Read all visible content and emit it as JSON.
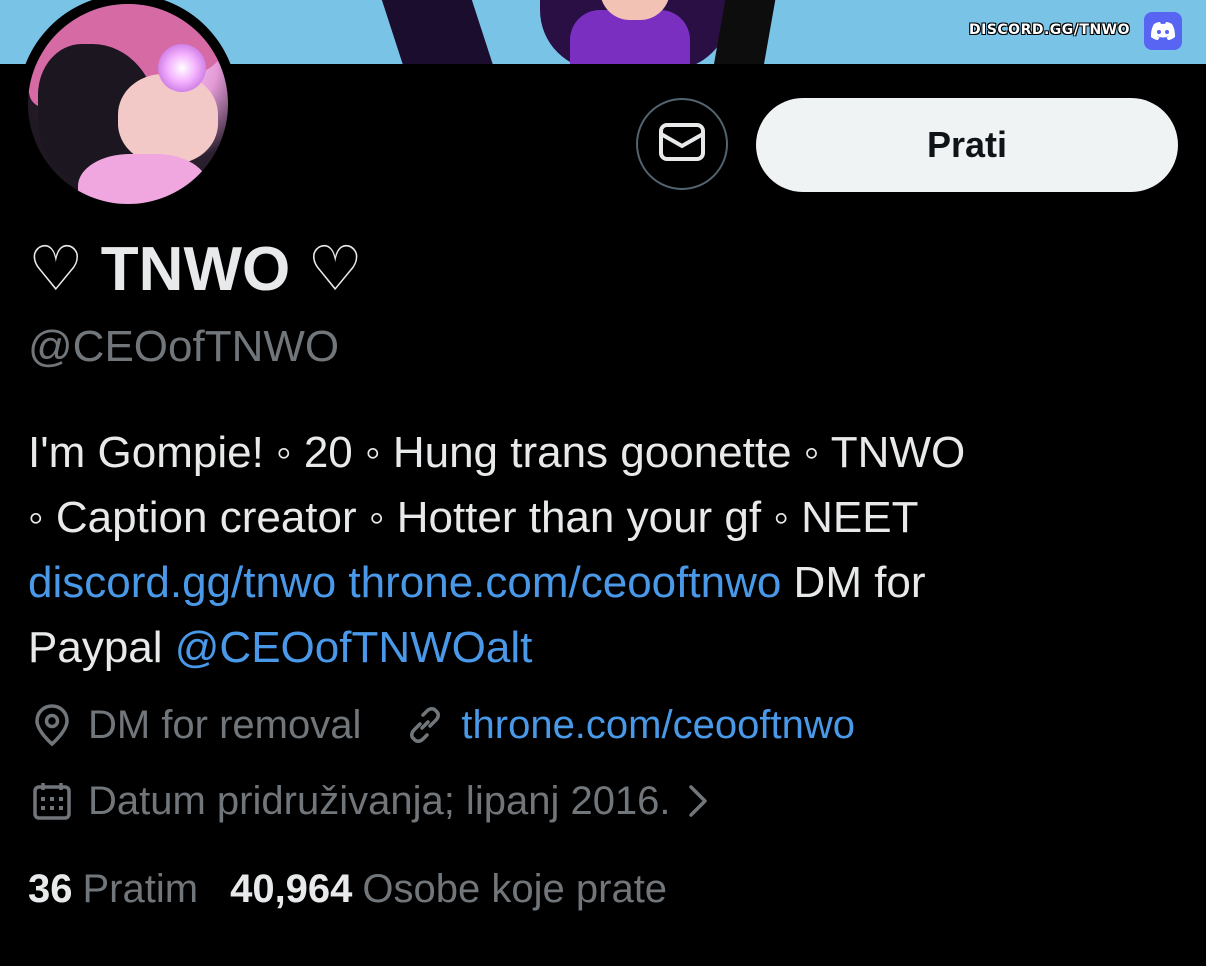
{
  "banner": {
    "text": "DISCORD.GG/TNWO",
    "icon": "discord-icon"
  },
  "profile": {
    "name": "♡ TNWO ♡",
    "handle": "@CEOofTNWO",
    "follow_label": "Prati",
    "message_icon": "envelope-icon"
  },
  "bio": {
    "line1": "I'm Gompie! ◦ 20 ◦ Hung trans goonette ◦ TNWO",
    "line2": "◦ Caption creator ◦ Hotter than your gf ◦ NEET",
    "link1": "discord.gg/tnwo",
    "link2": "throne.com/ceooftnwo",
    "text_after_links": " DM for",
    "line4_prefix": "Paypal ",
    "mention": "@CEOofTNWOalt"
  },
  "meta": {
    "location": "DM for removal",
    "website": "throne.com/ceooftnwo",
    "joined": "Datum pridruživanja; lipanj 2016."
  },
  "stats": {
    "following_count": "36",
    "following_label": "Pratim",
    "followers_count": "40,964",
    "followers_label": "Osobe koje prate"
  },
  "colors": {
    "link": "#4a99e9",
    "muted": "#71767b",
    "text": "#e7e9ea",
    "follow_bg": "#eff3f4"
  }
}
